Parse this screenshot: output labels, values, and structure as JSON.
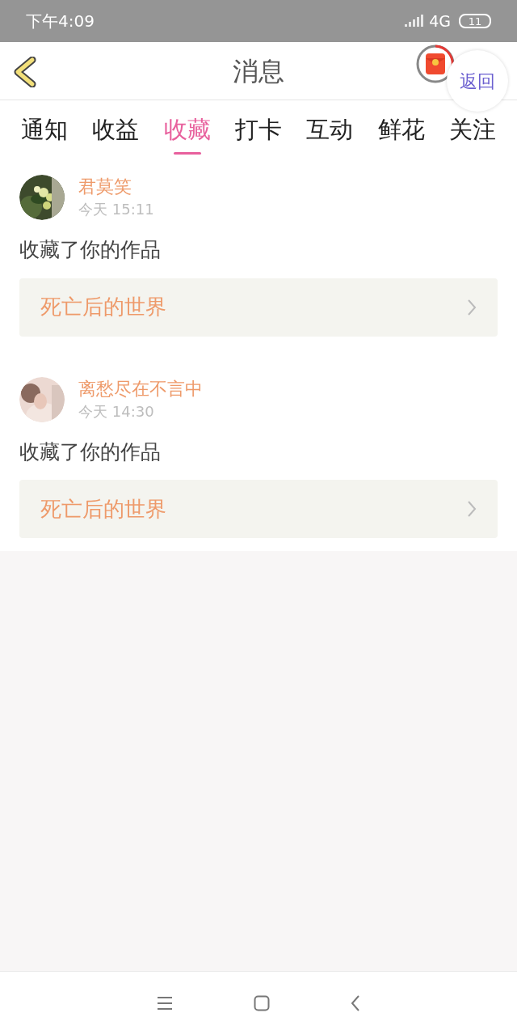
{
  "status_bar": {
    "time": "下午4:09",
    "network": "4G",
    "battery": "11"
  },
  "header": {
    "title": "消息",
    "floating_button": "返回"
  },
  "tabs": [
    {
      "label": "通知",
      "selected": false
    },
    {
      "label": "收益",
      "selected": false
    },
    {
      "label": "收藏",
      "selected": true
    },
    {
      "label": "打卡",
      "selected": false
    },
    {
      "label": "互动",
      "selected": false
    },
    {
      "label": "鲜花",
      "selected": false
    },
    {
      "label": "关注",
      "selected": false
    }
  ],
  "messages": [
    {
      "user": "君莫笑",
      "time": "今天 15:11",
      "action": "收藏了你的作品",
      "work": "死亡后的世界"
    },
    {
      "user": "离愁尽在不言中",
      "time": "今天 14:30",
      "action": "收藏了你的作品",
      "work": "死亡后的世界"
    }
  ]
}
